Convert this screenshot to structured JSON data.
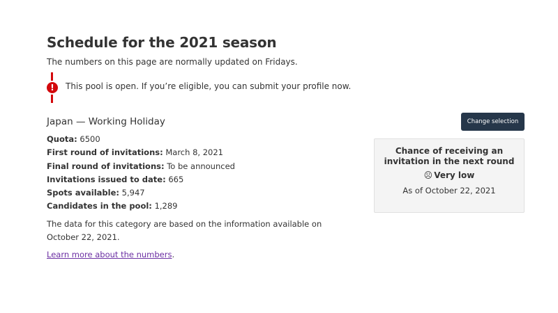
{
  "header": {
    "title": "Schedule for the 2021 season",
    "subtitle": "The numbers on this page are normally updated on Fridays."
  },
  "alert": {
    "icon": "exclamation-circle-icon",
    "text": "This pool is open. If you’re eligible, you can submit your profile now.",
    "color": "#d3080c"
  },
  "category": {
    "title": "Japan — Working Holiday",
    "stats": [
      {
        "label": "Quota:",
        "value": "6500"
      },
      {
        "label": "First round of invitations:",
        "value": "March 8, 2021"
      },
      {
        "label": "Final round of invitations:",
        "value": "To be announced"
      },
      {
        "label": "Invitations issued to date:",
        "value": "665"
      },
      {
        "label": "Spots available:",
        "value": "5,947"
      },
      {
        "label": "Candidates in the pool:",
        "value": "1,289"
      }
    ],
    "note": "The data for this category are based on the information available on October 22, 2021.",
    "learn_more": "Learn more about the numbers",
    "learn_more_suffix": "."
  },
  "toolbar": {
    "change_selection": "Change selection",
    "button_color": "#26374a"
  },
  "chance": {
    "heading": "Chance of receiving an invitation in the next round",
    "icon": "sad-face-icon",
    "value": "Very low",
    "as_of": "As of October 22, 2021"
  }
}
